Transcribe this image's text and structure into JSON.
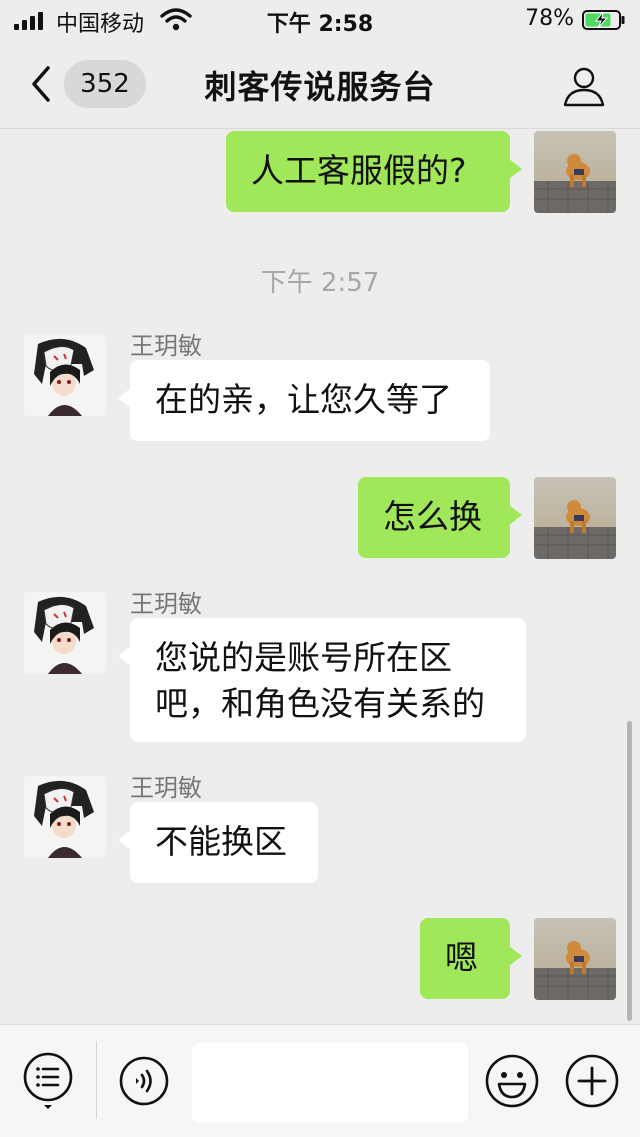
{
  "status_bar": {
    "carrier": "中国移动",
    "time": "下午 2:58",
    "battery": "78%"
  },
  "nav": {
    "unread_count": "352",
    "title": "刺客传说服务台"
  },
  "messages": [
    {
      "from": "me",
      "text": "人工客服假的?"
    },
    {
      "timestamp": "下午 2:57"
    },
    {
      "from": "cs",
      "sender": "王玥敏",
      "text": "在的亲，让您久等了"
    },
    {
      "from": "me",
      "text": "怎么换"
    },
    {
      "from": "cs",
      "sender": "王玥敏",
      "text_line1": "您说的是账号所在区",
      "text_line2": "吧，和角色没有关系的"
    },
    {
      "from": "cs",
      "sender": "王玥敏",
      "text": "不能换区"
    },
    {
      "from": "me",
      "text": "嗯"
    }
  ],
  "icons": {
    "back": "chevron-left-icon",
    "profile": "person-icon",
    "menu": "list-icon",
    "voice": "voice-icon",
    "emoji": "smile-icon",
    "plus": "plus-icon"
  },
  "colors": {
    "my_bubble": "#a0e75a",
    "their_bubble": "#ffffff",
    "background": "#ededed",
    "battery_fill": "#4cd964"
  }
}
